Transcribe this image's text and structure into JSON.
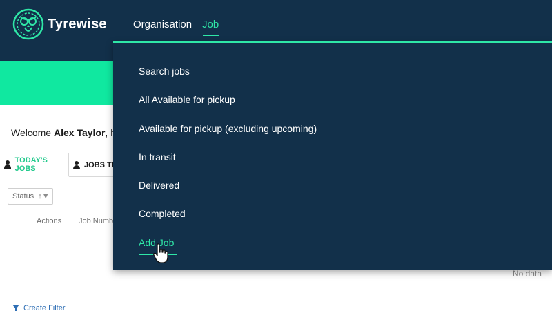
{
  "app": {
    "brand": "Tyrewise",
    "logo_icon": "owl-logo-icon",
    "accent_color": "#2fe7a7",
    "header_color": "#12304a",
    "banner_color": "#10e8a0"
  },
  "nav": {
    "organisation": "Organisation",
    "job": "Job",
    "active": "Job"
  },
  "welcome": {
    "prefix": "Welcome",
    "user": "Alex Taylor",
    "suffix": ", he"
  },
  "tabs": {
    "today": "TODAY'S JOBS",
    "other": "JOBS TI"
  },
  "table": {
    "filter_label": "Status",
    "filter_icons": "sort-filter-icon",
    "columns": [
      "Actions",
      "Job Numbe"
    ],
    "empty_text": "No data"
  },
  "footer": {
    "create_filter": "Create Filter"
  },
  "job_menu": {
    "items": [
      "Search jobs",
      "All Available for pickup",
      "Available for pickup (excluding upcoming)",
      "In transit",
      "Delivered",
      "Completed",
      "Add Job"
    ],
    "hovered": "Add Job"
  }
}
